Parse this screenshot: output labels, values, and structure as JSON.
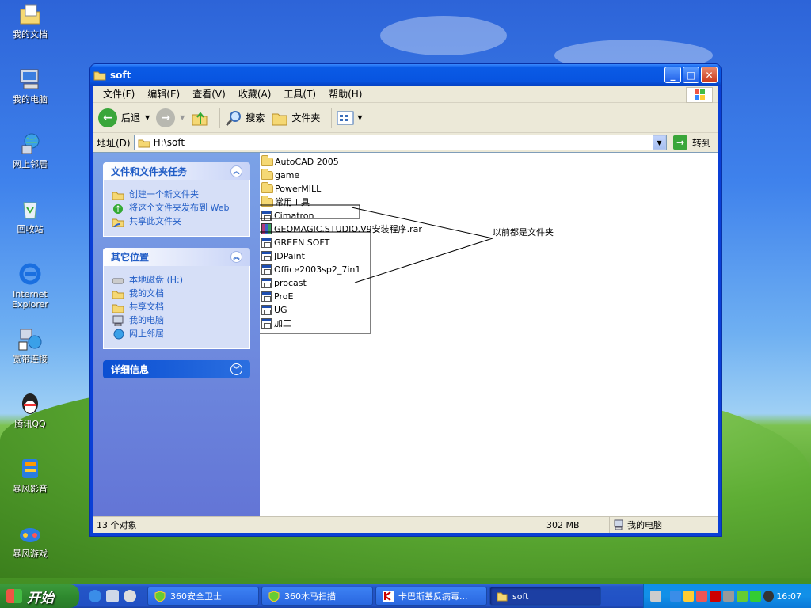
{
  "desktop": {
    "icons": [
      {
        "label": "我的文档",
        "icon": "my-documents-icon"
      },
      {
        "label": "我的电脑",
        "icon": "my-computer-icon"
      },
      {
        "label": "网上邻居",
        "icon": "network-places-icon"
      },
      {
        "label": "回收站",
        "icon": "recycle-bin-icon"
      },
      {
        "label": "Internet Explorer",
        "icon": "internet-explorer-icon"
      },
      {
        "label": "宽带连接",
        "icon": "broadband-connection-icon"
      },
      {
        "label": "腾讯QQ",
        "icon": "qq-icon"
      },
      {
        "label": "暴风影音",
        "icon": "baofeng-player-icon"
      },
      {
        "label": "暴风游戏",
        "icon": "baofeng-games-icon"
      }
    ]
  },
  "window": {
    "title": "soft",
    "menu": [
      "文件(F)",
      "编辑(E)",
      "查看(V)",
      "收藏(A)",
      "工具(T)",
      "帮助(H)"
    ],
    "toolbar": {
      "back": "后退",
      "search": "搜索",
      "folders": "文件夹"
    },
    "address": {
      "label": "地址(D)",
      "value": "H:\\soft",
      "go": "转到"
    },
    "tasks_panel": {
      "title": "文件和文件夹任务",
      "items": [
        "创建一个新文件夹",
        "将这个文件夹发布到 Web",
        "共享此文件夹"
      ]
    },
    "places_panel": {
      "title": "其它位置",
      "items": [
        "本地磁盘 (H:)",
        "我的文档",
        "共享文档",
        "我的电脑",
        "网上邻居"
      ]
    },
    "details_panel": {
      "title": "详细信息"
    },
    "files": [
      {
        "name": "AutoCAD 2005",
        "type": "folder"
      },
      {
        "name": "game",
        "type": "folder"
      },
      {
        "name": "PowerMILL",
        "type": "folder"
      },
      {
        "name": "常用工具",
        "type": "folder"
      },
      {
        "name": "Cimatron",
        "type": "exe"
      },
      {
        "name": "GEOMAGIC.STUDIO.V9安装程序.rar",
        "type": "rar"
      },
      {
        "name": "GREEN SOFT",
        "type": "exe"
      },
      {
        "name": "JDPaint",
        "type": "exe"
      },
      {
        "name": "Office2003sp2_7in1",
        "type": "exe"
      },
      {
        "name": "procast",
        "type": "exe"
      },
      {
        "name": "ProE",
        "type": "exe"
      },
      {
        "name": "UG",
        "type": "exe"
      },
      {
        "name": "加工",
        "type": "exe"
      }
    ],
    "annotation": "以前都是文件夹",
    "status": {
      "count": "13 个对象",
      "size": "302 MB",
      "location": "我的电脑"
    }
  },
  "taskbar": {
    "start": "开始",
    "tasks": [
      {
        "label": "360安全卫士",
        "active": false
      },
      {
        "label": "360木马扫描",
        "active": false
      },
      {
        "label": "卡巴斯基反病毒...",
        "active": false
      },
      {
        "label": "soft",
        "active": true
      }
    ],
    "clock": "16:07"
  },
  "colors": {
    "titlebar": "#0a5be6",
    "sidebar": "#6f8fe0",
    "taskbar": "#2456c7",
    "start": "#2f8a2f"
  }
}
